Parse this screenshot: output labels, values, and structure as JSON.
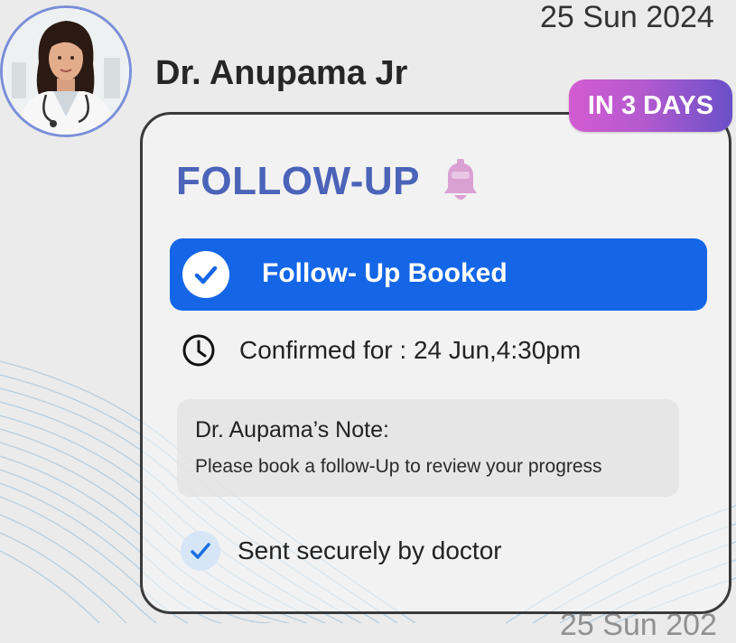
{
  "header": {
    "date": "25 Sun 2024",
    "doctor_name": "Dr. Anupama Jr",
    "avatar_icon": "doctor-photo"
  },
  "badge": {
    "label": "IN 3 DAYS"
  },
  "card": {
    "title": "FOLLOW-UP",
    "title_icon": "bell-icon",
    "booked_label": "Follow- Up Booked",
    "confirmed_text": "Confirmed for : 24 Jun,4:30pm",
    "note_title": "Dr. Aupama’s Note:",
    "note_body": "Please book a follow-Up to review your progress",
    "sent_text": "Sent securely by doctor"
  },
  "footer": {
    "date_partial": "25 Sun 202"
  },
  "colors": {
    "accent_blue": "#1466e6",
    "title_blue": "#4b63b8",
    "bell_pink": "#d9a0d2",
    "badge_gradient_start": "#d35bd1",
    "badge_gradient_end": "#6950c8"
  }
}
